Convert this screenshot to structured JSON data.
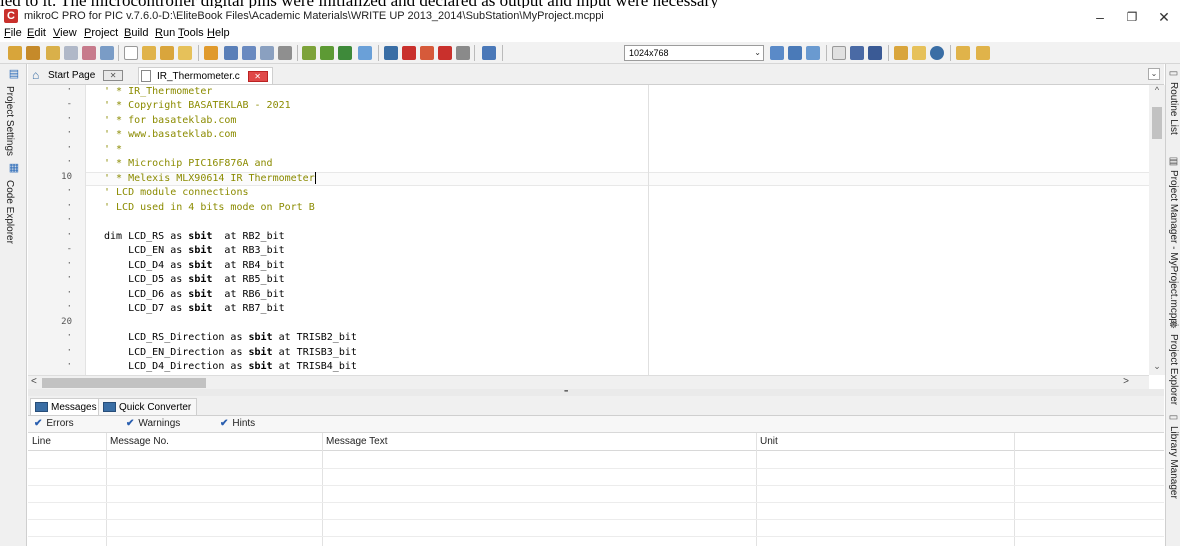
{
  "document_caption": "led to it. The microcontroller digital pins were initialized and declared as output and input were necessary",
  "window": {
    "app_icon": "C",
    "title": "mikroC PRO for PIC v.7.6.0-D:\\EliteBook Files\\Academic Materials\\WRITE UP 2013_2014\\SubStation\\MyProject.mcppi",
    "minimize": "–",
    "restore": "❐",
    "close": "✕"
  },
  "menu": [
    {
      "key": "F",
      "rest": "ile"
    },
    {
      "key": "E",
      "rest": "dit"
    },
    {
      "key": "V",
      "rest": "iew"
    },
    {
      "key": "P",
      "rest": "roject"
    },
    {
      "key": "B",
      "rest": "uild"
    },
    {
      "key": "R",
      "rest": "un"
    },
    {
      "key": "T",
      "rest": "ools"
    },
    {
      "key": "H",
      "rest": "elp"
    }
  ],
  "toolbar": {
    "resolution_value": "1024x768",
    "resolution_arrow": "⌄"
  },
  "left_panel": {
    "tabs": [
      "Project Settings",
      "Code Explorer"
    ]
  },
  "right_panel": {
    "tabs": [
      "Routine List",
      "Project Manager - MyProject.mcppi",
      "Project Explorer",
      "Library Manager"
    ]
  },
  "editor_tabs": {
    "start_page": "Start Page",
    "file": "IR_Thermometer.c",
    "close_glyph": "✕",
    "scroll_glyph": "⌄"
  },
  "gutter": [
    "·",
    "-",
    "·",
    "·",
    "·",
    "·",
    "10",
    "·",
    "·",
    "·",
    "·",
    "-",
    "·",
    "·",
    "·",
    "·",
    "20",
    "·",
    "·",
    "·"
  ],
  "code": {
    "l1": "' * IR_Thermometer",
    "l2": "' * Copyright BASATEKLAB - 2021",
    "l3": "' * for basateklab.com",
    "l4": "' * www.basateklab.com",
    "l5": "' *",
    "l6": "' * Microchip PIC16F876A and",
    "l7": "' * Melexis MLX90614 IR Thermometer",
    "l8": "' LCD module connections",
    "l9": "' LCD used in 4 bits mode on Port B",
    "rs": {
      "pre": "dim LCD_RS as ",
      "kw": "sbit",
      "post": "  at RB2_bit"
    },
    "en": {
      "pre": "    LCD_EN as ",
      "kw": "sbit",
      "post": "  at RB3_bit"
    },
    "d4": {
      "pre": "    LCD_D4 as ",
      "kw": "sbit",
      "post": "  at RB4_bit"
    },
    "d5": {
      "pre": "    LCD_D5 as ",
      "kw": "sbit",
      "post": "  at RB5_bit"
    },
    "d6": {
      "pre": "    LCD_D6 as ",
      "kw": "sbit",
      "post": "  at RB6_bit"
    },
    "d7": {
      "pre": "    LCD_D7 as ",
      "kw": "sbit",
      "post": "  at RB7_bit"
    },
    "rsd": {
      "pre": "    LCD_RS_Direction as ",
      "kw": "sbit",
      "post": " at TRISB2_bit"
    },
    "end": {
      "pre": "    LCD_EN_Direction as ",
      "kw": "sbit",
      "post": " at TRISB3_bit"
    },
    "d4d": {
      "pre": "    LCD_D4_Direction as ",
      "kw": "sbit",
      "post": " at TRISB4_bit"
    }
  },
  "scroll": {
    "up": "^",
    "down": "⌄",
    "left": "<",
    "right": ">",
    "grip": "''''''''''"
  },
  "messages": {
    "tab_messages": "Messages",
    "tab_converter": "Quick Converter",
    "filters": [
      {
        "check": "✔",
        "label": "Errors"
      },
      {
        "check": "✔",
        "label": "Warnings"
      },
      {
        "check": "✔",
        "label": "Hints"
      }
    ],
    "columns": [
      "Line",
      "Message No.",
      "Message Text",
      "Unit"
    ]
  }
}
